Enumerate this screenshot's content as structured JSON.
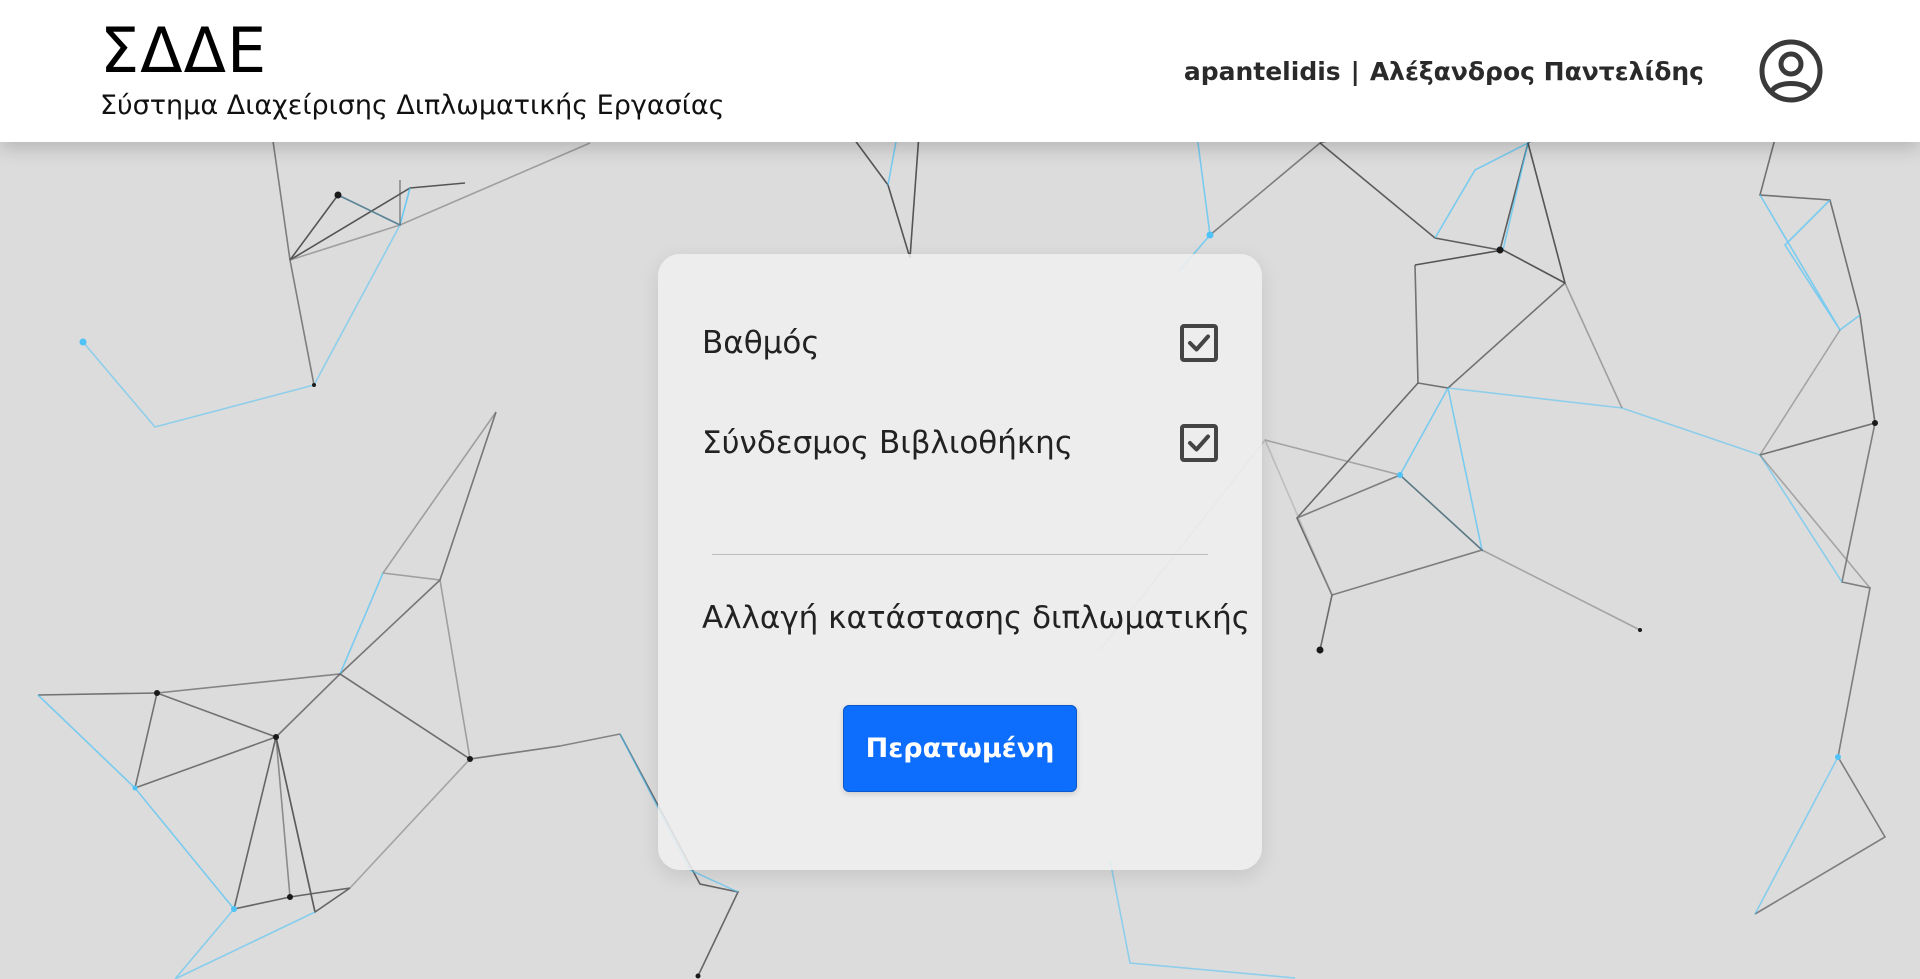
{
  "header": {
    "app_title": "ΣΔΔΕ",
    "app_subtitle": "Σύστημα Διαχείρισης Διπλωματικής Εργασίας",
    "username": "apantelidis",
    "separator": "|",
    "full_name": "Αλέξανδρος Παντελίδης",
    "avatar_icon": "user-circle-icon"
  },
  "card": {
    "items": [
      {
        "label": "Βαθμός",
        "checked": true
      },
      {
        "label": "Σύνδεσμος Βιβλιοθήκης",
        "checked": true
      }
    ],
    "status_label": "Αλλαγή κατάστασης διπλωματικής",
    "status_button": "Περατωμένη"
  },
  "colors": {
    "primary": "#0d6efd",
    "background": "#dcdcdc",
    "header_bg": "#ffffff",
    "network_dark": "#2b2b2b",
    "network_blue": "#4fc3f7"
  }
}
